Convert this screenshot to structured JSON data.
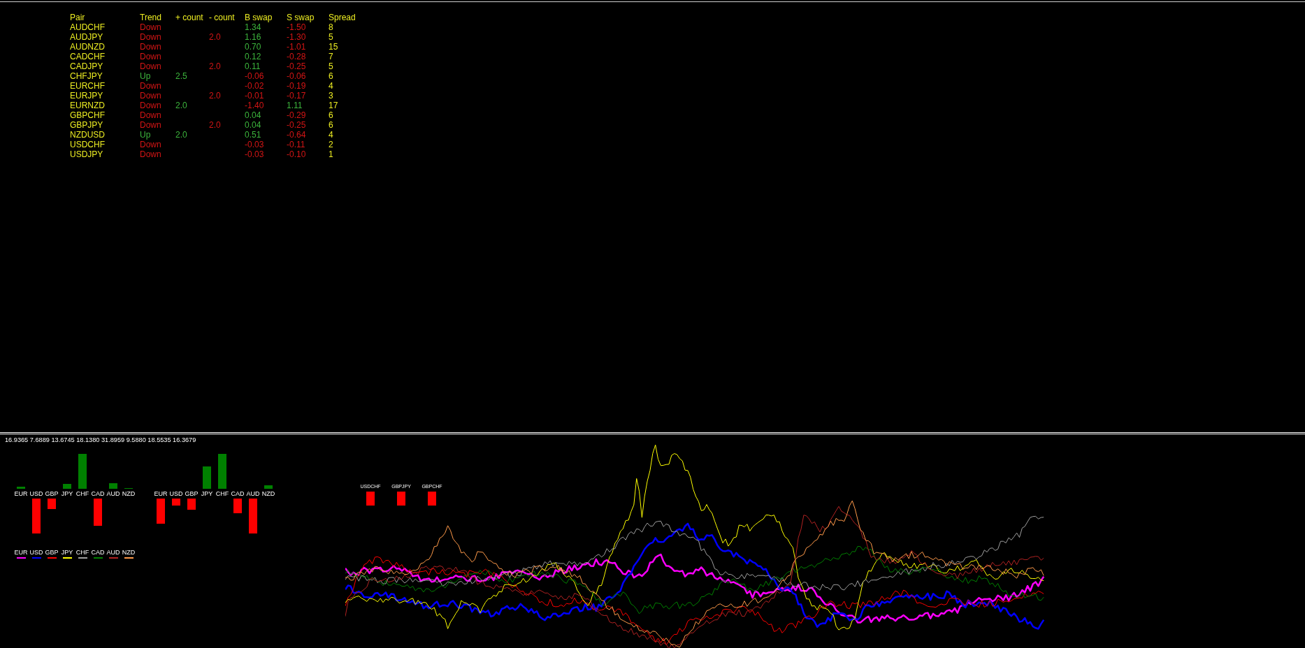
{
  "chart_window": {
    "table": {
      "columns": [
        "Pair",
        "Trend",
        "+ count",
        "- count",
        "B swap",
        "S swap",
        "Spread"
      ],
      "rows": [
        {
          "pair": "AUDCHF",
          "trend": {
            "text": "Down",
            "up": false
          },
          "b_swap": {
            "text": "1.34",
            "positive": true
          },
          "s_swap": {
            "text": "-1.50",
            "positive": false
          },
          "spread": "8"
        },
        {
          "pair": "AUDJPY",
          "trend": {
            "text": "Down",
            "up": false
          },
          "minus_count": "2.0",
          "b_swap": {
            "text": "1.16",
            "positive": true
          },
          "s_swap": {
            "text": "-1.30",
            "positive": false
          },
          "spread": "5"
        },
        {
          "pair": "AUDNZD",
          "trend": {
            "text": "Down",
            "up": false
          },
          "b_swap": {
            "text": "0.70",
            "positive": true
          },
          "s_swap": {
            "text": "-1.01",
            "positive": false
          },
          "spread": "15"
        },
        {
          "pair": "CADCHF",
          "trend": {
            "text": "Down",
            "up": false
          },
          "b_swap": {
            "text": "0.12",
            "positive": true
          },
          "s_swap": {
            "text": "-0.28",
            "positive": false
          },
          "spread": "7"
        },
        {
          "pair": "CADJPY",
          "trend": {
            "text": "Down",
            "up": false
          },
          "minus_count": "2.0",
          "b_swap": {
            "text": "0.11",
            "positive": true
          },
          "s_swap": {
            "text": "-0.25",
            "positive": false
          },
          "spread": "5"
        },
        {
          "pair": "CHFJPY",
          "trend": {
            "text": "Up",
            "up": true
          },
          "plus_count": "2.5",
          "b_swap": {
            "text": "-0.06",
            "positive": false
          },
          "s_swap": {
            "text": "-0.06",
            "positive": false
          },
          "spread": "6"
        },
        {
          "pair": "EURCHF",
          "trend": {
            "text": "Down",
            "up": false
          },
          "b_swap": {
            "text": "-0.02",
            "positive": false
          },
          "s_swap": {
            "text": "-0.19",
            "positive": false
          },
          "spread": "4"
        },
        {
          "pair": "EURJPY",
          "trend": {
            "text": "Down",
            "up": false
          },
          "minus_count": "2.0",
          "b_swap": {
            "text": "-0.01",
            "positive": false
          },
          "s_swap": {
            "text": "-0.17",
            "positive": false
          },
          "spread": "3"
        },
        {
          "pair": "EURNZD",
          "trend": {
            "text": "Down",
            "up": false
          },
          "plus_count": "2.0",
          "b_swap": {
            "text": "-1.40",
            "positive": false
          },
          "s_swap": {
            "text": "1.11",
            "positive": true
          },
          "spread": "17"
        },
        {
          "pair": "GBPCHF",
          "trend": {
            "text": "Down",
            "up": false
          },
          "b_swap": {
            "text": "0.04",
            "positive": true
          },
          "s_swap": {
            "text": "-0.29",
            "positive": false
          },
          "spread": "6"
        },
        {
          "pair": "GBPJPY",
          "trend": {
            "text": "Down",
            "up": false
          },
          "minus_count": "2.0",
          "b_swap": {
            "text": "0.04",
            "positive": true
          },
          "s_swap": {
            "text": "-0.25",
            "positive": false
          },
          "spread": "6"
        },
        {
          "pair": "NZDUSD",
          "trend": {
            "text": "Up",
            "up": true
          },
          "plus_count": "2.0",
          "b_swap": {
            "text": "0.51",
            "positive": true
          },
          "s_swap": {
            "text": "-0.64",
            "positive": false
          },
          "spread": "4"
        },
        {
          "pair": "USDCHF",
          "trend": {
            "text": "Down",
            "up": false
          },
          "b_swap": {
            "text": "-0.03",
            "positive": false
          },
          "s_swap": {
            "text": "-0.11",
            "positive": false
          },
          "spread": "2"
        },
        {
          "pair": "USDJPY",
          "trend": {
            "text": "Down",
            "up": false
          },
          "b_swap": {
            "text": "-0.03",
            "positive": false
          },
          "s_swap": {
            "text": "-0.10",
            "positive": false
          },
          "spread": "1"
        }
      ]
    }
  },
  "indicator_window": {
    "values": "16.9365 7.6889 13.6745 18.1380 31.8959 9.5880 18.5535 16.3679",
    "strength_charts": [
      {
        "labels": [
          "EUR",
          "USD",
          "GBP",
          "JPY",
          "CHF",
          "CAD",
          "AUD",
          "NZD"
        ]
      },
      {
        "labels": [
          "EUR",
          "USD",
          "GBP",
          "JPY",
          "CHF",
          "CAD",
          "AUD",
          "NZD"
        ]
      }
    ],
    "legend": [
      {
        "label": "EUR",
        "color": "#ff00ff"
      },
      {
        "label": "USD",
        "color": "#0000ff"
      },
      {
        "label": "GBP",
        "color": "#ff0000"
      },
      {
        "label": "JPY",
        "color": "#ffff00"
      },
      {
        "label": "CHF",
        "color": "#a0a0a0"
      },
      {
        "label": "CAD",
        "color": "#008000"
      },
      {
        "label": "AUD",
        "color": "#b22222"
      },
      {
        "label": "NZD",
        "color": "#ff9a4a"
      }
    ],
    "pair_signals": [
      {
        "label": "USDCHF"
      },
      {
        "label": "GBPJPY"
      },
      {
        "label": "GBPCHF"
      }
    ]
  }
}
